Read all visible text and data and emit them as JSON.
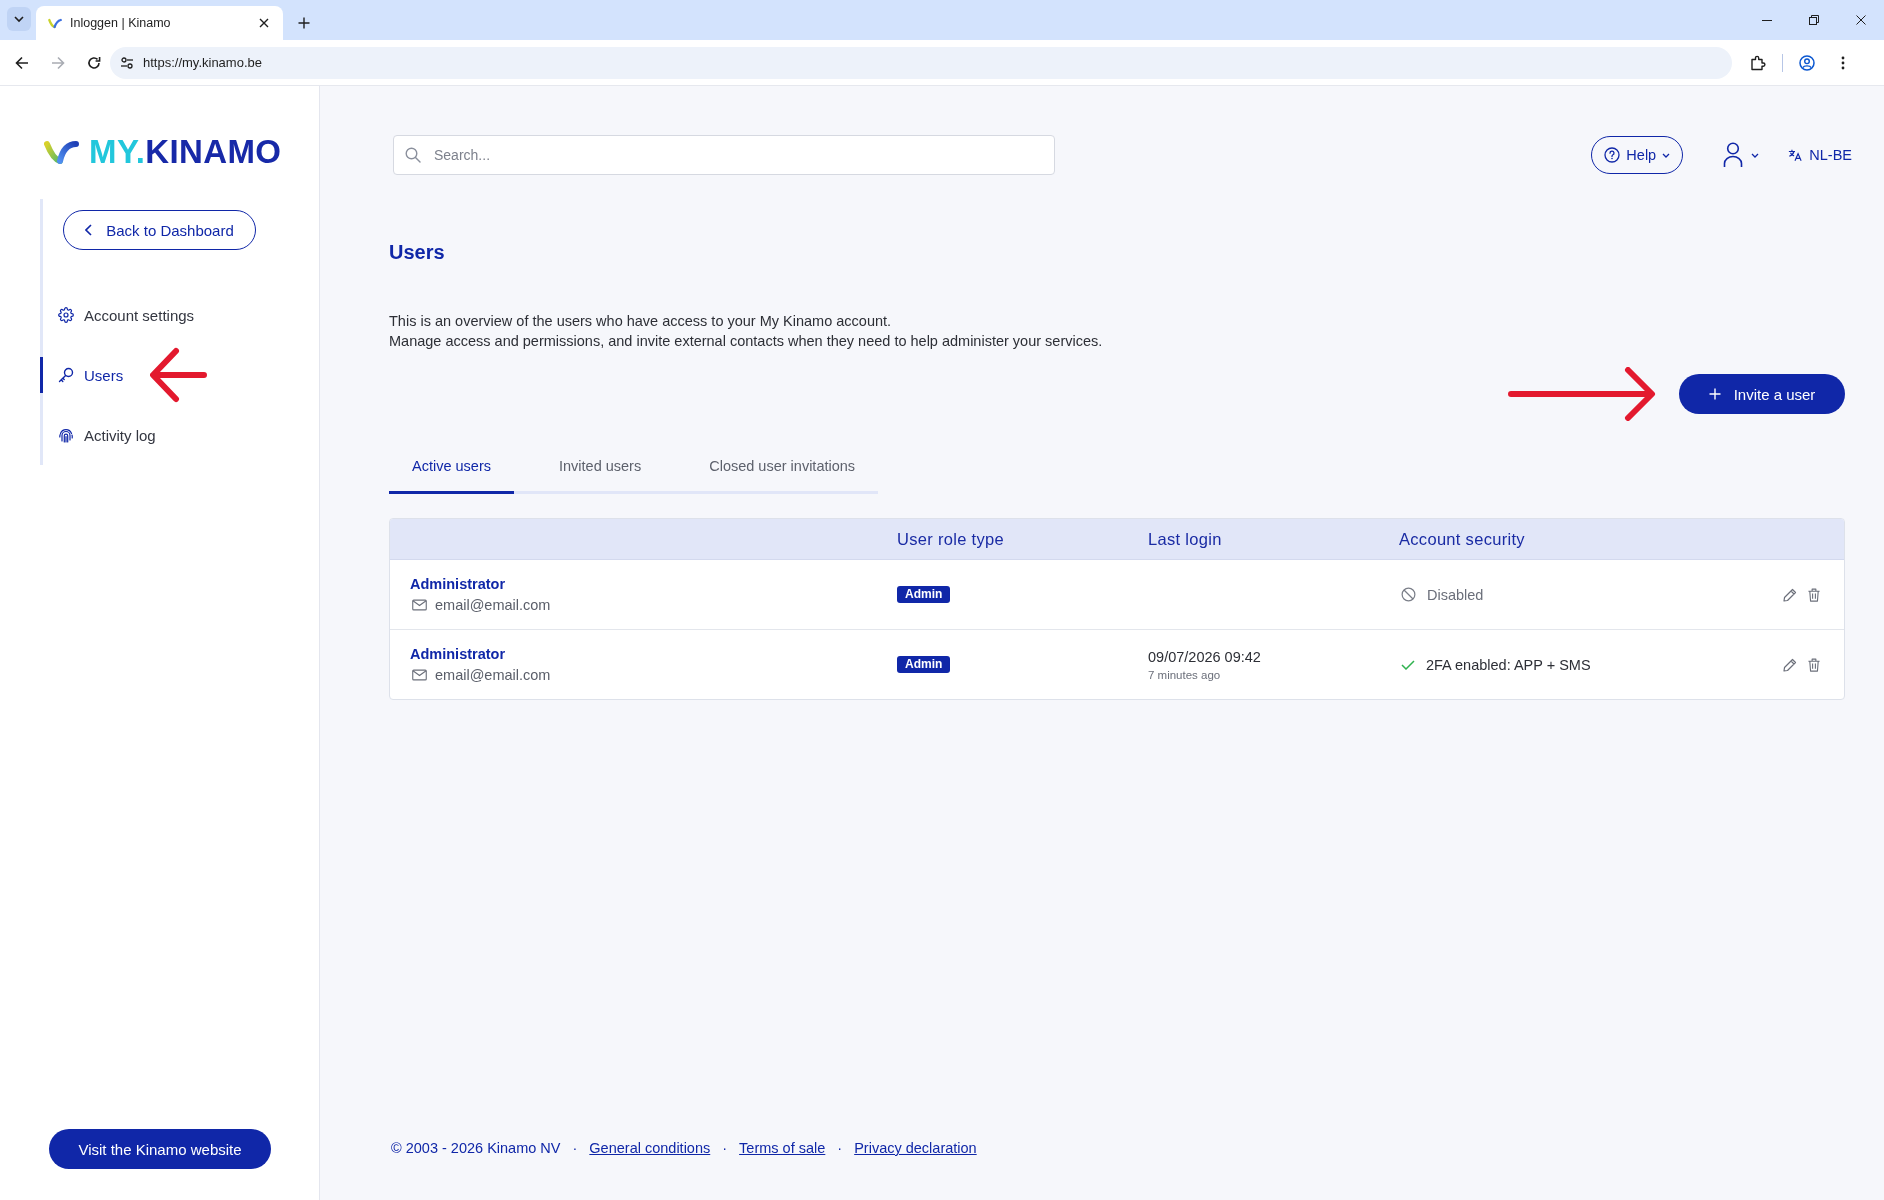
{
  "browser": {
    "tabs": [
      {
        "title": "Inloggen | Kinamo",
        "selected": true
      }
    ],
    "forward_disabled": true,
    "address": "https://my.kinamo.be"
  },
  "sidebar": {
    "logo": {
      "prefix": "MY.",
      "name": "KINAMO"
    },
    "back_button": "Back to Dashboard",
    "items": [
      {
        "label": "Account settings",
        "selected": false,
        "annotation_arrow": false
      },
      {
        "label": "Users",
        "selected": true,
        "annotation_arrow": true
      },
      {
        "label": "Activity log",
        "selected": false,
        "annotation_arrow": false
      }
    ],
    "website_button": "Visit the Kinamo website"
  },
  "header": {
    "search": {
      "placeholder": "Search..."
    },
    "help_button": "Help",
    "language": "NL-BE"
  },
  "page": {
    "title": "Users",
    "description": [
      "This is an overview of the users who have access to your My Kinamo account.",
      "Manage access and permissions, and invite external contacts when they need to help administer your services."
    ],
    "invite_button": {
      "label": "Invite a user",
      "annotation_arrow": true
    }
  },
  "tabs": [
    {
      "label": "Active users",
      "selected": true
    },
    {
      "label": "Invited users",
      "selected": false
    },
    {
      "label": "Closed user invitations",
      "selected": false
    }
  ],
  "table": {
    "columns": [
      "User role type",
      "Last login",
      "Account security"
    ],
    "rows": [
      {
        "name": "Administrator",
        "email": "email@email.com",
        "role": "Admin",
        "security": {
          "kind": "disabled",
          "label": "Disabled"
        }
      },
      {
        "name": "Administrator",
        "email": "email@email.com",
        "role": "Admin",
        "last_login": {
          "date": "09/07/2026 09:42",
          "relative": "7 minutes ago"
        },
        "security": {
          "kind": "enabled",
          "label": "2FA enabled: APP + SMS"
        }
      }
    ]
  },
  "footer": {
    "copyright": "© 2003 - 2026 Kinamo NV",
    "links": [
      {
        "separator": "·",
        "label": "General conditions"
      },
      {
        "separator": "·",
        "label": "Terms of sale"
      },
      {
        "separator": "·",
        "label": "Privacy declaration"
      }
    ]
  }
}
